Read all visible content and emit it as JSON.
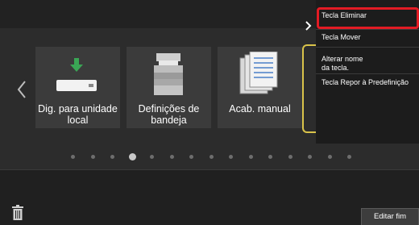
{
  "tiles": [
    {
      "label": "Dig. para unidade local",
      "icon": "usb-download-icon"
    },
    {
      "label": "Definições de bandeja",
      "icon": "printer-tray-icon"
    },
    {
      "label": "Acab. manual",
      "icon": "stacked-documents-icon"
    }
  ],
  "pager": {
    "count": 15,
    "active_index": 3
  },
  "context_menu": {
    "items": [
      "Tecla Eliminar",
      "Tecla Mover",
      "Alterar nome\nda tecla.",
      "Tecla Repor à Predefinição"
    ]
  },
  "footer": {
    "edit_end_label": "Editar fim"
  },
  "colors": {
    "highlight_red": "#e21b24",
    "highlight_yellow": "#d9c34a",
    "usb_green": "#3aa655"
  }
}
